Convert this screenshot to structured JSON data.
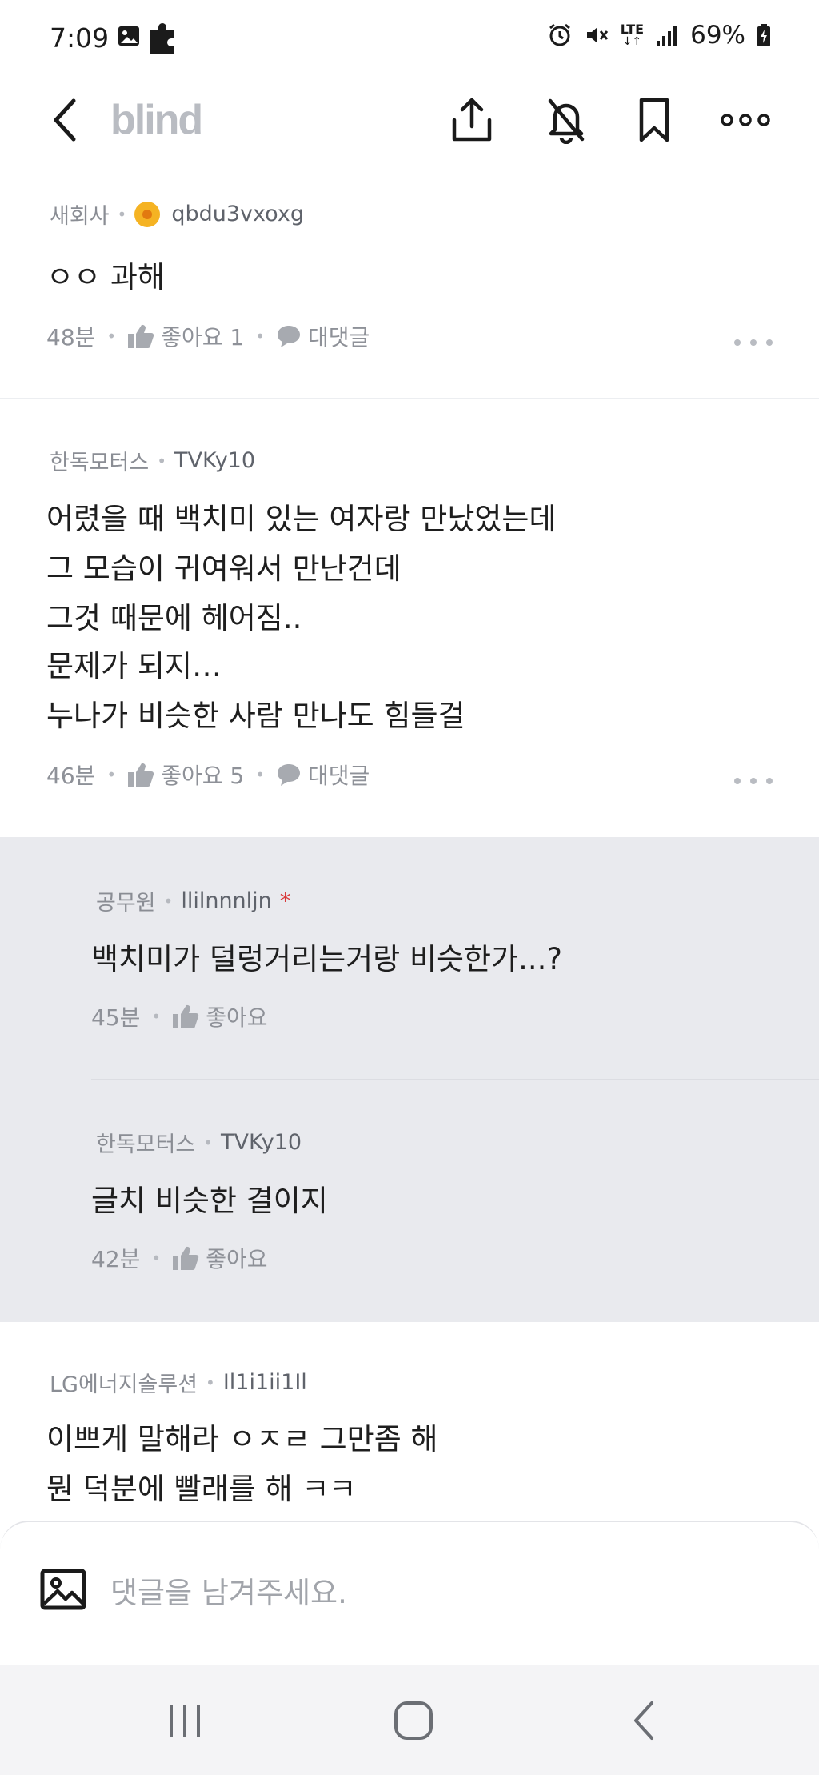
{
  "status_bar": {
    "time": "7:09",
    "network": "LTE",
    "battery": "69%"
  },
  "header": {
    "logo": "blind",
    "icons": [
      "back-icon",
      "share-icon",
      "notifications-off-icon",
      "bookmark-icon",
      "more-icon"
    ]
  },
  "comments": [
    {
      "company": "새회사",
      "nickname": "qbdu3vxoxg",
      "has_badge": true,
      "lines": [
        "ㅇㅇ 과해"
      ],
      "time": "48분",
      "like_label": "좋아요 1",
      "reply_label": "대댓글"
    },
    {
      "company": "한독모터스",
      "nickname": "TVKy10",
      "lines": [
        "어렸을 때 백치미 있는 여자랑 만났었는데",
        "그 모습이 귀여워서 만난건데",
        "그것 때문에 헤어짐..",
        "문제가 되지…",
        "누나가 비슷한 사람 만나도 힘들걸"
      ],
      "time": "46분",
      "like_label": "좋아요 5",
      "reply_label": "대댓글"
    }
  ],
  "replies": [
    {
      "company": "공무원",
      "nickname": "llilnnnljn",
      "author_mark": "*",
      "lines": [
        "백치미가 덜렁거리는거랑 비슷한가...?"
      ],
      "time": "45분",
      "like_label": "좋아요"
    },
    {
      "company": "한독모터스",
      "nickname": "TVKy10",
      "lines": [
        "글치 비슷한 결이지"
      ],
      "time": "42분",
      "like_label": "좋아요"
    }
  ],
  "last_comment": {
    "company": "LG에너지솔루션",
    "nickname": "Il1i1ii1Il",
    "lines": [
      "이쁘게 말해라 ㅇㅈㄹ 그만좀 해",
      "뭔 덕분에 빨래를 해 ㅋㅋ"
    ]
  },
  "comment_input": {
    "placeholder": "댓글을 남겨주세요."
  },
  "nav_bar": {
    "icons": [
      "recent-apps-icon",
      "home-icon",
      "nav-back-icon"
    ]
  }
}
